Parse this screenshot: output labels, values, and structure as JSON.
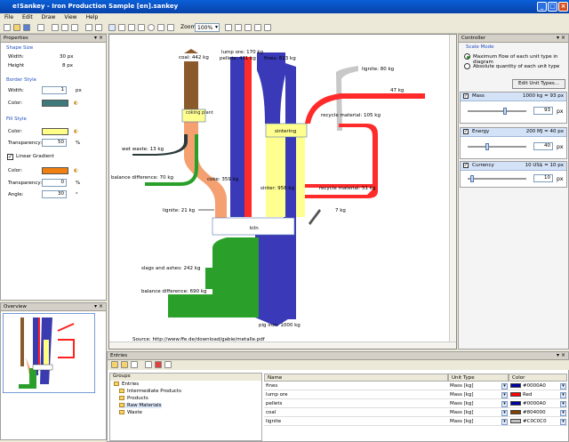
{
  "app": {
    "title": "e!Sankey - Iron Production Sample [en].sankey"
  },
  "menu": [
    "File",
    "Edit",
    "Draw",
    "View",
    "Help"
  ],
  "toolbar": {
    "zoom_label": "Zoom:",
    "zoom_value": "100%"
  },
  "properties": {
    "title": "Properties",
    "shape_size": {
      "label": "Shape Size",
      "width_label": "Width:",
      "width_value": "30 px",
      "height_label": "Height",
      "height_value": "8 px"
    },
    "border_style": {
      "label": "Border Style",
      "width_label": "Width:",
      "width_value": "1",
      "width_unit": "px",
      "color_label": "Color:",
      "color": "#3f7a7a"
    },
    "fill_style": {
      "label": "Fill Style",
      "color_label": "Color:",
      "color": "#ffff88",
      "transparency_label": "Transparency:",
      "transparency_value": "50",
      "transparency_unit": "%"
    },
    "linear_gradient": {
      "label": "Linear Gradient",
      "checked": true,
      "color_label": "Color:",
      "color": "#f08010",
      "transparency_label": "Transparency:",
      "transparency_value": "0",
      "transparency_unit": "%",
      "angle_label": "Angle:",
      "angle_value": "30",
      "angle_unit": "°"
    }
  },
  "overview": {
    "title": "Overview"
  },
  "controller": {
    "title": "Controller",
    "scale_mode": {
      "label": "Scale Mode",
      "option1": "Maximum flow of each unit type in diagram",
      "option2": "Absolute quantity of each unit type",
      "selected": 1
    },
    "edit_button": "Edit Unit Types...",
    "units": [
      {
        "name": "Mass",
        "scale": "1000 kg = 93 px",
        "value": "93",
        "unit": "px",
        "level": 0.6
      },
      {
        "name": "Energy",
        "scale": "200 MJ = 40 px",
        "value": "40",
        "unit": "px",
        "level": 0.3
      },
      {
        "name": "Currency",
        "scale": "10 US$ = 10 px",
        "value": "10",
        "unit": "px",
        "level": 0.05
      }
    ]
  },
  "diagram": {
    "labels": {
      "coal": "coal: 442 kg",
      "lump_ore": "lump ore: 170 kg",
      "pellets": "pellets: 431 kg",
      "fines": "fines: 823 kg",
      "lignite_top": "lignite: 80 kg",
      "out47": "47 kg",
      "recycle1": "recycle material: 105 kg",
      "coking_plant": "coking\nplant",
      "sintering": "sintering",
      "wet_waste": "wet waste: 13 kg",
      "balance1": "balance difference: 70 kg",
      "coke": "coke: 359 kg",
      "sinter": "sinter: 958 kg",
      "recycle2": "recycle material: 51 kg",
      "lignite2": "lignite: 21 kg",
      "kg7": "7 kg",
      "kiln": "kiln",
      "slags": "slags and ashes: 242 kg",
      "balance2": "balance difference: 690 kg",
      "pig_iron": "pig iron: 1000 kg",
      "source": "Source: http://www.ffe.de/download/gabie/metalle.pdf"
    }
  },
  "entries": {
    "title": "Entries",
    "groups_header": "Groups",
    "groups": [
      "Entries",
      "Intermediate Products",
      "Products",
      "Raw Materials",
      "Waste"
    ],
    "columns": [
      "Name",
      "Unit Type",
      "Color"
    ],
    "rows": [
      {
        "name": "fines",
        "unit": "Mass [kg]",
        "color_name": "#0000A0",
        "color": "#0000a0"
      },
      {
        "name": "lump ore",
        "unit": "Mass [kg]",
        "color_name": "Red",
        "color": "#ff0000"
      },
      {
        "name": "pellets",
        "unit": "Mass [kg]",
        "color_name": "#0000A0",
        "color": "#0000a0"
      },
      {
        "name": "coal",
        "unit": "Mass [kg]",
        "color_name": "#804000",
        "color": "#804000"
      },
      {
        "name": "lignite",
        "unit": "Mass [kg]",
        "color_name": "#C0C0C0",
        "color": "#c0c0c0"
      }
    ]
  }
}
